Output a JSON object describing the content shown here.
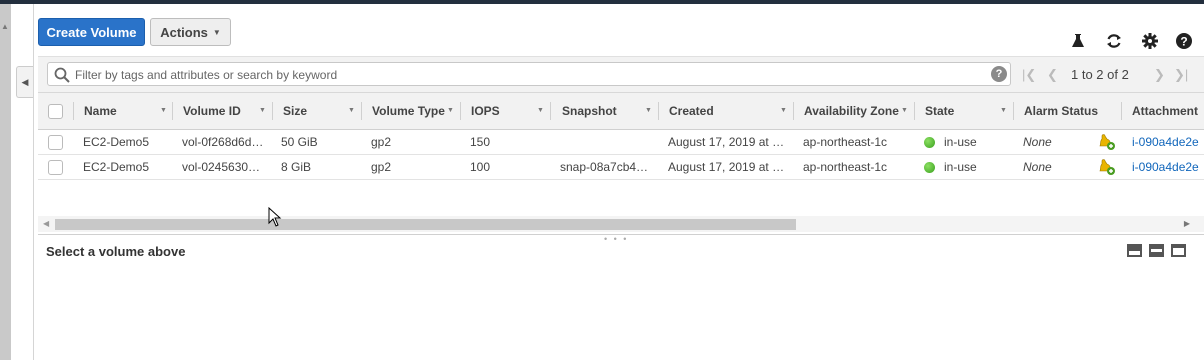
{
  "toolbar": {
    "create_label": "Create Volume",
    "actions_label": "Actions",
    "icons": [
      "flask-icon",
      "refresh-icon",
      "gear-icon",
      "help-icon"
    ]
  },
  "search": {
    "placeholder": "Filter by tags and attributes or search by keyword",
    "help_glyph": "?"
  },
  "pagination": {
    "label": "1 to 2 of 2"
  },
  "table": {
    "columns": [
      "Name",
      "Volume ID",
      "Size",
      "Volume Type",
      "IOPS",
      "Snapshot",
      "Created",
      "Availability Zone",
      "State",
      "Alarm Status",
      "Attachment"
    ],
    "rows": [
      {
        "name": "EC2-Demo5",
        "volume_id": "vol-0f268d6d…",
        "size": "50 GiB",
        "volume_type": "gp2",
        "iops": "150",
        "snapshot": "",
        "created": "August 17, 2019 at …",
        "availability_zone": "ap-northeast-1c",
        "state": "in-use",
        "state_color": "#3aa01e",
        "alarm_status": "None",
        "attachment": "i-090a4de2e"
      },
      {
        "name": "EC2-Demo5",
        "volume_id": "vol-0245630…",
        "size": "8 GiB",
        "volume_type": "gp2",
        "iops": "100",
        "snapshot": "snap-08a7cb4…",
        "created": "August 17, 2019 at …",
        "availability_zone": "ap-northeast-1c",
        "state": "in-use",
        "state_color": "#3aa01e",
        "alarm_status": "None",
        "attachment": "i-090a4de2e"
      }
    ]
  },
  "details": {
    "title": "Select a volume above"
  },
  "colors": {
    "primary_button": "#2a73c9",
    "link": "#1166bb",
    "top_bar": "#232f3e"
  }
}
